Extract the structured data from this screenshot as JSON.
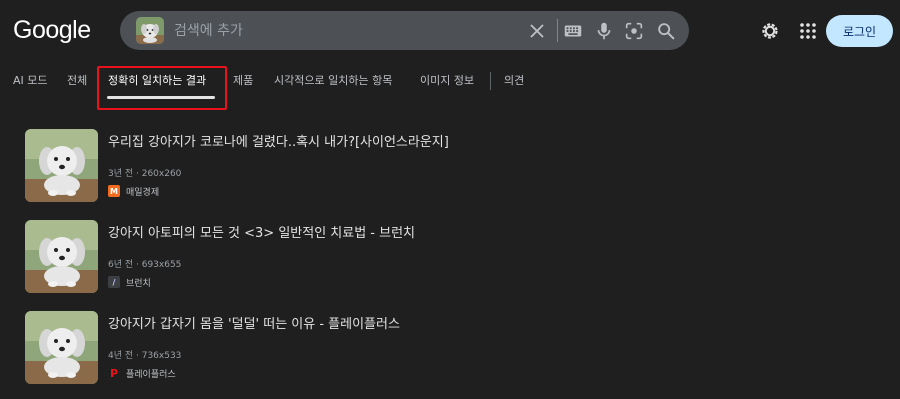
{
  "logo": {
    "text": "Google"
  },
  "search": {
    "placeholder": "검색에 추가",
    "icons": [
      "image-query-thumbnail",
      "close-icon",
      "keyboard-icon",
      "mic-icon",
      "lens-icon",
      "search-icon"
    ]
  },
  "header": {
    "icons": [
      "gear-icon",
      "apps-grid-icon"
    ],
    "login_label": "로그인"
  },
  "tabs": [
    {
      "label": "AI 모드",
      "active": false
    },
    {
      "label": "전체",
      "active": false
    },
    {
      "label": "정확히 일치하는 결과",
      "active": true
    },
    {
      "label": "제품",
      "active": false
    },
    {
      "label": "시각적으로 일치하는 항목",
      "active": false
    },
    {
      "label": "이미지 정보",
      "active": false
    },
    {
      "label": "의견",
      "active": false
    }
  ],
  "results": [
    {
      "title": "우리집 강아지가 코로나에 걸렸다..혹시 내가?[사이언스라운지]",
      "meta": "3년 전 · 260x260",
      "source": "매일경제",
      "favicon": {
        "icon": "maeil-business-icon",
        "color": "#f26b21",
        "glyph": "M"
      }
    },
    {
      "title": "강아지 아토피의 모든 것 <3> 일반적인 치료법 - 브런치",
      "meta": "6년 전 · 693x655",
      "source": "브런치",
      "favicon": {
        "icon": "brunch-icon",
        "color": "#3c4043",
        "glyph": "/"
      }
    },
    {
      "title": "강아지가 갑자기 몸을 '덜덜' 떠는 이유 - 플레이플러스",
      "meta": "4년 전 · 736x533",
      "source": "플레이플러스",
      "favicon": {
        "icon": "playplus-icon",
        "color": "#e8131a",
        "glyph": "P"
      }
    }
  ],
  "colors": {
    "background": "#1f1f1f",
    "search_bar": "#4d5156",
    "login_bg": "#c2e7ff",
    "highlight": "#e8131a"
  }
}
